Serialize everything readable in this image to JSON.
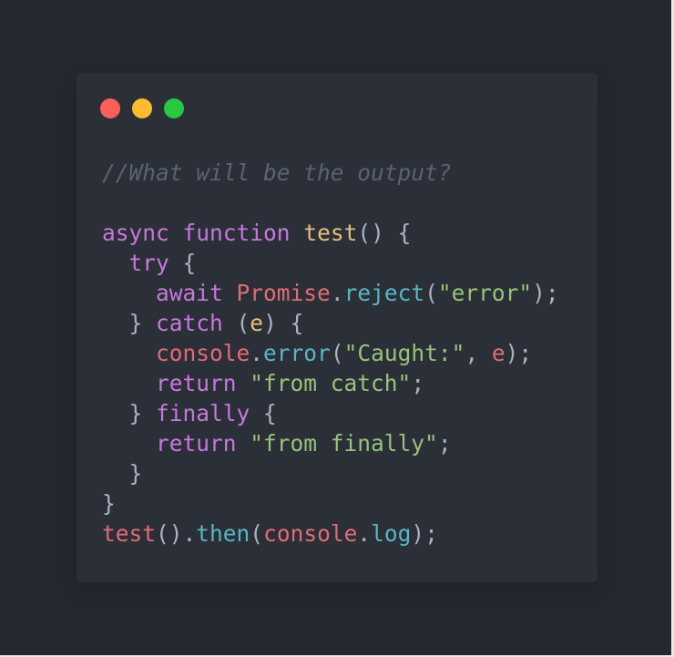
{
  "colors": {
    "background": "#242931",
    "window": "#2b2f37",
    "traffic_close": "#ff5f57",
    "traffic_minimize": "#febc2e",
    "traffic_maximize": "#28c840",
    "comment": "#5c6370",
    "keyword": "#c678dd",
    "function_name": "#e5c07b",
    "punctuation": "#abb2bf",
    "string": "#98c379",
    "method": "#56b6c2",
    "identifier": "#e06c75"
  },
  "window_controls": {
    "close_icon": "close-icon",
    "minimize_icon": "minimize-icon",
    "maximize_icon": "maximize-icon"
  },
  "code_lines": [
    [
      [
        "//What will be the output?",
        "comment"
      ]
    ],
    [],
    [
      [
        "async",
        "keyword"
      ],
      [
        " ",
        "punctuation"
      ],
      [
        "function",
        "keyword"
      ],
      [
        " ",
        "punctuation"
      ],
      [
        "test",
        "function_name"
      ],
      [
        "() {",
        "punctuation"
      ]
    ],
    [
      [
        "  ",
        "punctuation"
      ],
      [
        "try",
        "keyword"
      ],
      [
        " {",
        "punctuation"
      ]
    ],
    [
      [
        "    ",
        "punctuation"
      ],
      [
        "await",
        "keyword"
      ],
      [
        " ",
        "punctuation"
      ],
      [
        "Promise",
        "identifier"
      ],
      [
        ".",
        "punctuation"
      ],
      [
        "reject",
        "method"
      ],
      [
        "(",
        "punctuation"
      ],
      [
        "\"error\"",
        "string"
      ],
      [
        ");",
        "punctuation"
      ]
    ],
    [
      [
        "  } ",
        "punctuation"
      ],
      [
        "catch",
        "keyword"
      ],
      [
        " (",
        "punctuation"
      ],
      [
        "e",
        "function_name"
      ],
      [
        ") {",
        "punctuation"
      ]
    ],
    [
      [
        "    ",
        "punctuation"
      ],
      [
        "console",
        "identifier"
      ],
      [
        ".",
        "punctuation"
      ],
      [
        "error",
        "method"
      ],
      [
        "(",
        "punctuation"
      ],
      [
        "\"Caught:\"",
        "string"
      ],
      [
        ", ",
        "punctuation"
      ],
      [
        "e",
        "identifier"
      ],
      [
        ");",
        "punctuation"
      ]
    ],
    [
      [
        "    ",
        "punctuation"
      ],
      [
        "return",
        "keyword"
      ],
      [
        " ",
        "punctuation"
      ],
      [
        "\"from catch\"",
        "string"
      ],
      [
        ";",
        "punctuation"
      ]
    ],
    [
      [
        "  } ",
        "punctuation"
      ],
      [
        "finally",
        "keyword"
      ],
      [
        " {",
        "punctuation"
      ]
    ],
    [
      [
        "    ",
        "punctuation"
      ],
      [
        "return",
        "keyword"
      ],
      [
        " ",
        "punctuation"
      ],
      [
        "\"from finally\"",
        "string"
      ],
      [
        ";",
        "punctuation"
      ]
    ],
    [
      [
        "  }",
        "punctuation"
      ]
    ],
    [
      [
        "}",
        "punctuation"
      ]
    ],
    [
      [
        "test",
        "identifier"
      ],
      [
        "().",
        "punctuation"
      ],
      [
        "then",
        "method"
      ],
      [
        "(",
        "punctuation"
      ],
      [
        "console",
        "identifier"
      ],
      [
        ".",
        "punctuation"
      ],
      [
        "log",
        "method"
      ],
      [
        ");",
        "punctuation"
      ]
    ]
  ]
}
